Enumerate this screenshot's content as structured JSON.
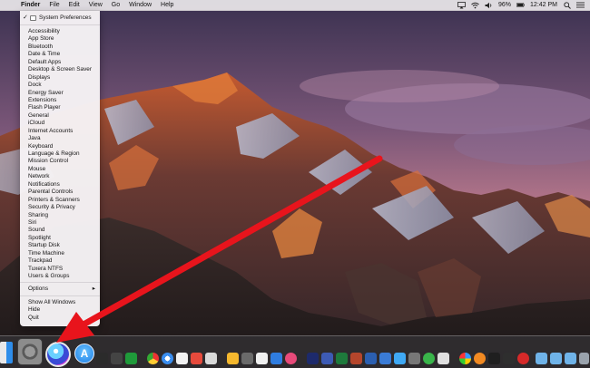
{
  "menubar": {
    "apple": "",
    "items": [
      "Finder",
      "File",
      "Edit",
      "View",
      "Go",
      "Window",
      "Help"
    ],
    "battery": "96%",
    "time": "12:42 PM"
  },
  "dropdown": {
    "header": "System Preferences",
    "items": [
      "Accessibility",
      "App Store",
      "Bluetooth",
      "Date & Time",
      "Default Apps",
      "Desktop & Screen Saver",
      "Displays",
      "Dock",
      "Energy Saver",
      "Extensions",
      "Flash Player",
      "General",
      "iCloud",
      "Internet Accounts",
      "Java",
      "Keyboard",
      "Language & Region",
      "Mission Control",
      "Mouse",
      "Network",
      "Notifications",
      "Parental Controls",
      "Printers & Scanners",
      "Security & Privacy",
      "Sharing",
      "Siri",
      "Sound",
      "Spotlight",
      "Startup Disk",
      "Time Machine",
      "Trackpad",
      "Tuxera NTFS",
      "Users & Groups"
    ],
    "options": "Options",
    "show_all": "Show All Windows",
    "hide": "Hide",
    "quit": "Quit"
  },
  "colors": {
    "arrow": "#e8141c",
    "sky_top": "#39324f",
    "sky_mid": "#b9708f",
    "mountain_glow": "#e07a3a"
  },
  "icons": {
    "apple": "apple-icon",
    "spotlight": "search-icon",
    "wifi": "wifi-icon",
    "battery": "battery-icon"
  }
}
